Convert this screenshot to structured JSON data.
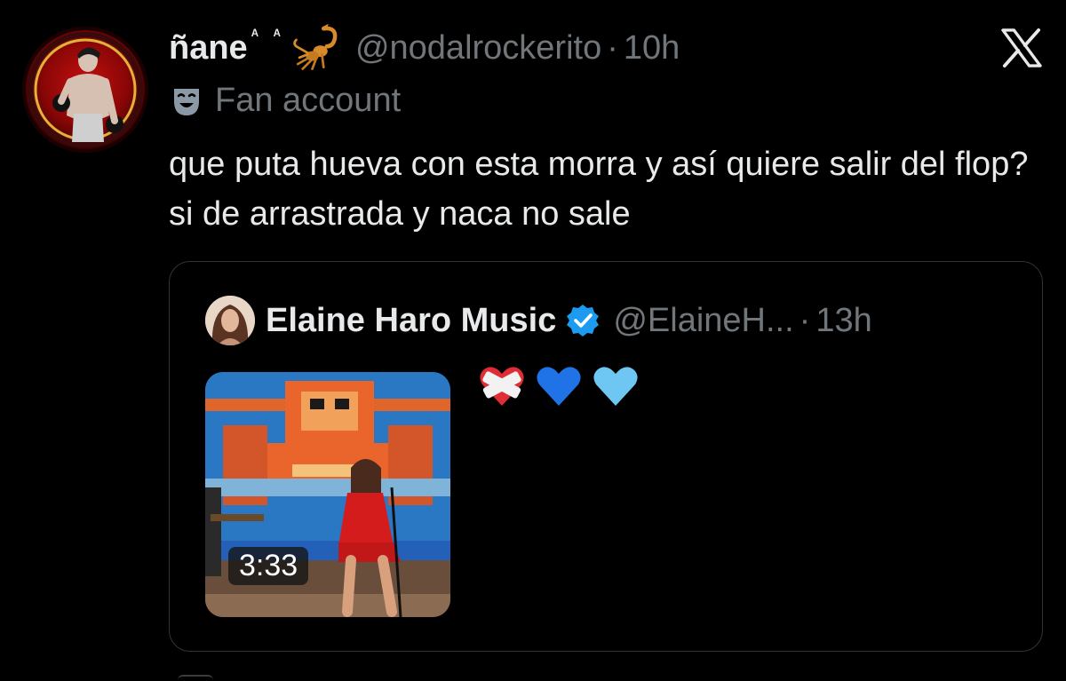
{
  "tweet": {
    "display_name": "ñane",
    "name_suffix": "ᴬ ᴬ",
    "handle": "@nodalrockerito",
    "separator": "·",
    "time": "10h",
    "label": "Fan account",
    "text": "que puta hueva con esta morra y así quiere salir del flop? si de arrastrada y naca no sale"
  },
  "quoted": {
    "display_name": "Elaine Haro Music",
    "handle": "@ElaineH...",
    "separator": "·",
    "time": "13h",
    "media_duration": "3:33",
    "emojis": [
      "heart-with-bandage",
      "blue-heart",
      "light-blue-heart"
    ]
  },
  "colors": {
    "background": "#000000",
    "text_primary": "#e7e9ea",
    "text_secondary": "#71767b",
    "border": "#2f3336",
    "verified_blue": "#1d9bf0"
  },
  "icons": {
    "platform_logo": "x-logo-icon",
    "label_icon": "theater-mask-icon",
    "badge": "verified-badge-icon",
    "name_emoji": "scorpion-icon"
  }
}
